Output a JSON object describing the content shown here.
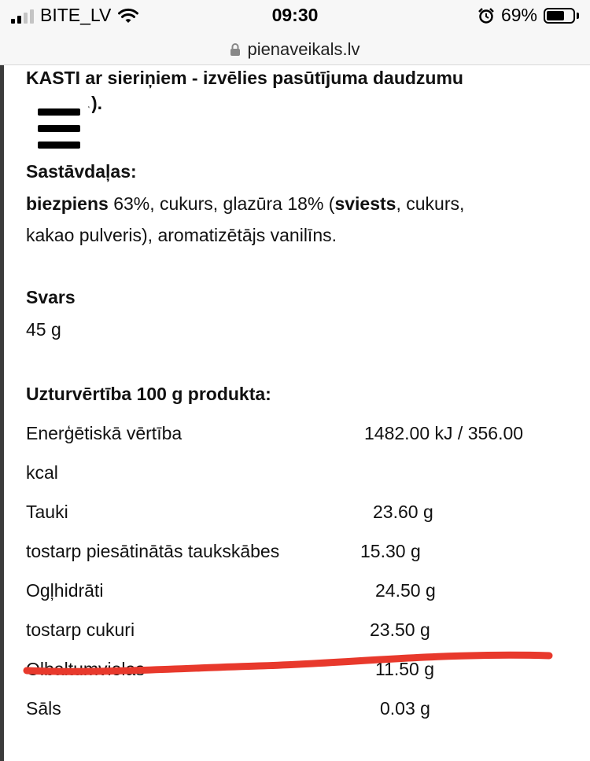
{
  "status": {
    "carrier": "BITE_LV",
    "time": "09:30",
    "battery": "69%",
    "battery_level": 0.69
  },
  "browser": {
    "url": "pienaveikals.lv"
  },
  "content": {
    "heading_line1": "KASTI ar sieriņiem - izvēlies pasūtījuma daudzumu",
    "heading_line2_partial": "…).",
    "ingredients_title": "Sastāvdaļas:",
    "ingredients": {
      "b1": "biezpiens",
      "t1": " 63%, cukurs, glazūra 18% (",
      "b2": "sviests",
      "t2": ", cukurs,",
      "t3": "kakao pulveris), aromatizētājs vanilīns."
    },
    "weight_title": "Svars",
    "weight_value": "45 g",
    "nutrition_title": "Uzturvērtība 100 g produkta:",
    "energy_label": "Enerģētiskā vērtība",
    "energy_value": "1482.00 kJ / 356.00",
    "energy_unit": "kcal",
    "rows": [
      {
        "label": "Tauki",
        "value": "23.60 g"
      },
      {
        "label": "tostarp piesātinātās taukskābes",
        "value": "15.30 g"
      },
      {
        "label": "Ogļhidrāti",
        "value": "24.50 g"
      },
      {
        "label": "tostarp cukuri",
        "value": "23.50 g"
      },
      {
        "label": "Olbaltumvielas",
        "value": "11.50 g"
      },
      {
        "label": "Sāls",
        "value": "0.03 g"
      }
    ]
  },
  "colors": {
    "annotation_stroke": "#e8392c",
    "page_bg": "#ffffff",
    "chrome_bg": "#f7f7f7"
  }
}
